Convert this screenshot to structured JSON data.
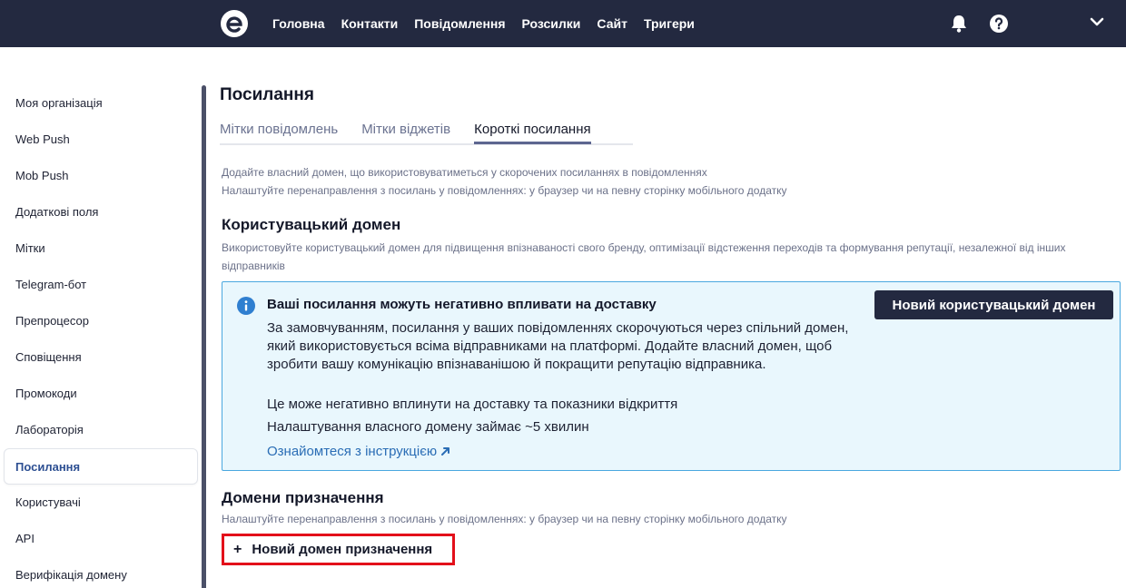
{
  "topbar": {
    "logo_icon": "e-logo-icon",
    "nav": [
      "Головна",
      "Контакти",
      "Повідомлення",
      "Розсилки",
      "Сайт",
      "Тригери"
    ],
    "notifications_icon": "bell-icon",
    "help_icon": "question-icon",
    "menu_icon": "chevron-down-icon"
  },
  "sidebar": {
    "items": [
      {
        "label": "Моя організація"
      },
      {
        "label": "Web Push"
      },
      {
        "label": "Mob Push"
      },
      {
        "label": "Додаткові поля"
      },
      {
        "label": "Мітки"
      },
      {
        "label": "Telegram-бот"
      },
      {
        "label": "Препроцесор"
      },
      {
        "label": "Сповіщення"
      },
      {
        "label": "Промокоди"
      },
      {
        "label": "Лабораторія"
      },
      {
        "label": "Посилання",
        "active": true
      },
      {
        "label": "Користувачі"
      },
      {
        "label": "API"
      },
      {
        "label": "Верифікація домену"
      }
    ]
  },
  "main": {
    "title": "Посилання",
    "tabs": [
      {
        "label": "Мітки повідомлень"
      },
      {
        "label": "Мітки віджетів"
      },
      {
        "label": "Короткі посилання",
        "active": true
      }
    ],
    "intro_line1": "Додайте власний домен, що використовуватиметься у скорочених посиланнях в повідомленнях",
    "intro_line2": "Налаштуйте перенаправлення з посилань у повідомленнях: у браузер чи на певну сторінку мобільного додатку",
    "custom_domain": {
      "heading": "Користувацький домен",
      "description": "Використовуйте користувацький домен для підвищення впізнаваності свого бренду, оптимізації відстеження переходів та формування репутації, незалежної від інших відправників"
    },
    "info": {
      "icon": "info-icon",
      "title": "Ваші посилання можуть негативно впливати на доставку",
      "body": "За замовчуванням, посилання у ваших повідомленнях скорочуються через спільний домен, який використовується всіма відправниками на платформі. Додайте власний домен, щоб зробити вашу комунікацію впізнаванішою й покращити репутацію відправника.",
      "line2": "Це може негативно вплинути на доставку та показники відкриття",
      "line3": "Налаштування власного домену займає ~5 хвилин",
      "link": "Ознайомтеся з інструкцією",
      "link_icon": "external-arrow-icon",
      "button": "Новий користувацький домен"
    },
    "destination": {
      "heading": "Домени призначення",
      "description": "Налаштуйте перенаправлення з посилань у повідомленнях: у браузер чи на певну сторінку мобільного додатку",
      "add_icon": "+",
      "add_button": "Новий домен призначення"
    }
  },
  "colors": {
    "topbar": "#232940",
    "accent_link": "#2a6db5",
    "info_bg": "#e9f7fd",
    "info_border": "#4aa8df",
    "highlight_border": "#e3101a"
  }
}
